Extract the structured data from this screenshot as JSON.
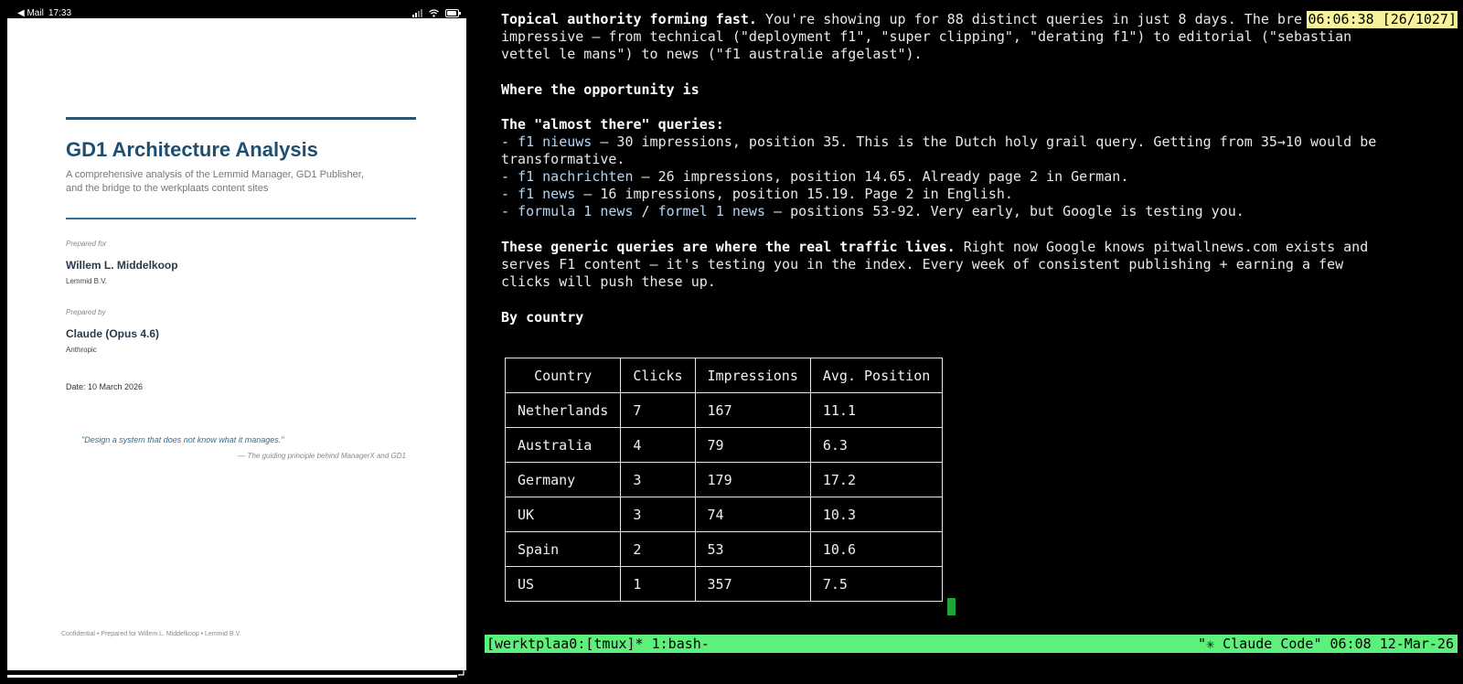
{
  "ipad": {
    "status": {
      "back": "◀ Mail",
      "time": "17:33"
    },
    "doc": {
      "title": "GD1 Architecture Analysis",
      "subtitle_1": "A comprehensive analysis of the Lemmid Manager, GD1 Publisher,",
      "subtitle_2": "and the bridge to the werkplaats content sites",
      "prepared_for_label": "Prepared for",
      "prepared_for_name": "Willem L. Middelkoop",
      "prepared_for_org": "Lemmid B.V.",
      "prepared_by_label": "Prepared by",
      "prepared_by_name": "Claude (Opus 4.6)",
      "prepared_by_org": "Anthropic",
      "date": "Date: 10 March 2026",
      "quote": "\"Design a system that does not know what it manages.\"",
      "quote_attr": "— The guiding principle behind ManagerX and GD1",
      "footer": "Confidential  •  Prepared for Willem L. Middelkoop  •  Lemmid B.V."
    }
  },
  "terminal": {
    "timer": "06:06:38 [26/1027]",
    "p1_bold": "Topical authority forming fast.",
    "p1_rest": " You're showing up for 88 distinct queries in just 8 days. The bre",
    "p1_l2": "impressive — from technical (\"deployment f1\", \"super clipping\", \"derating f1\") to editorial (\"sebastian",
    "p1_l3": "vettel le mans\") to news (\"f1 australie afgelast\").",
    "h_opportunity": "Where the opportunity is",
    "h_almost": "The \"almost there\" queries:",
    "dash": "- ",
    "q1_term": "f1 nieuws",
    "q1_rest": " — 30 impressions, position 35. This is the Dutch holy grail query. Getting from 35→10 would be",
    "q1_cont": "transformative.",
    "q2_term": "f1 nachrichten",
    "q2_rest": " — 26 impressions, position 14.65. Already page 2 in German.",
    "q3_term": "f1 news",
    "q3_rest": " — 16 impressions, position 15.19. Page 2 in English.",
    "q4_term_a": "formula 1 news",
    "q4_sep": " / ",
    "q4_term_b": "formel 1 news",
    "q4_rest": " — positions 53-92. Very early, but Google is testing you.",
    "p2_bold": "These generic queries are where the real traffic lives.",
    "p2_rest": " Right now Google knows pitwallnews.com exists and",
    "p2_l2": "serves F1 content — it's testing you in the index. Every week of consistent publishing + earning a few",
    "p2_l3": "clicks will push these up.",
    "h_country": "By country",
    "table": {
      "headers": [
        "Country",
        "Clicks",
        "Impressions",
        "Avg. Position"
      ],
      "rows": [
        [
          "Netherlands",
          "7",
          "167",
          "11.1"
        ],
        [
          "Australia",
          "4",
          "79",
          "6.3"
        ],
        [
          "Germany",
          "3",
          "179",
          "17.2"
        ],
        [
          "UK",
          "3",
          "74",
          "10.3"
        ],
        [
          "Spain",
          "2",
          "53",
          "10.6"
        ],
        [
          "US",
          "1",
          "357",
          "7.5"
        ]
      ]
    },
    "tmux_left": "[werktplaa0:[tmux]* 1:bash-",
    "tmux_right": "\"✳ Claude Code\" 06:08 12-Mar-26"
  },
  "colors": {
    "tmux_bar": "#5df07a",
    "timer_bg": "#f7f39a",
    "doc_title": "#1f4e6e",
    "link": "#b4d4f4"
  }
}
